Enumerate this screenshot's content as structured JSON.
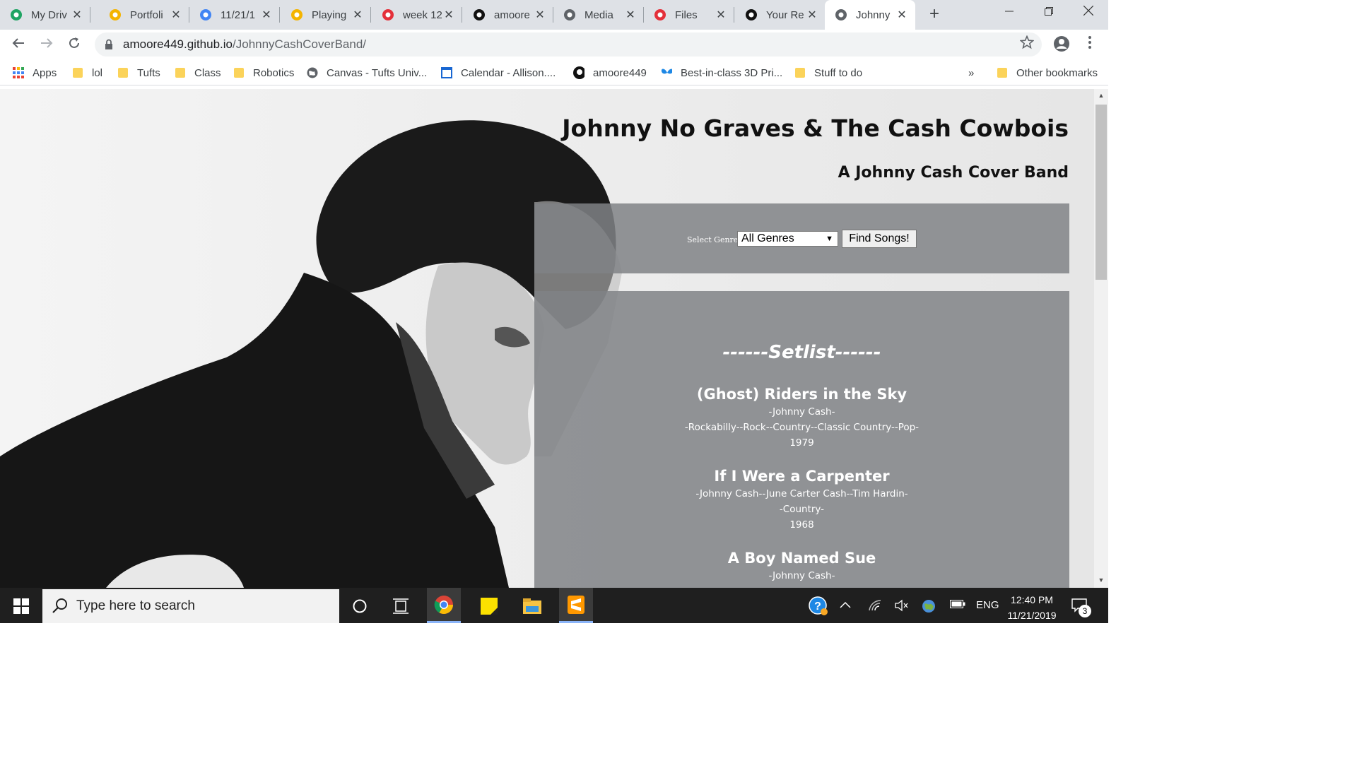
{
  "browser": {
    "tabs": [
      {
        "title": "My Driv",
        "icon": "google-drive-icon",
        "color": "#1fa463"
      },
      {
        "title": "Portfoli",
        "icon": "google-slides-icon",
        "color": "#f4b400"
      },
      {
        "title": "11/21/1",
        "icon": "google-docs-icon",
        "color": "#4285f4"
      },
      {
        "title": "Playing",
        "icon": "google-slides-icon",
        "color": "#f4b400"
      },
      {
        "title": "week 12",
        "icon": "canvas-icon",
        "color": "#e4303a"
      },
      {
        "title": "amoore",
        "icon": "github-icon",
        "color": "#111111"
      },
      {
        "title": "Media",
        "icon": "globe-icon",
        "color": "#5f6368"
      },
      {
        "title": "Files",
        "icon": "canvas-icon",
        "color": "#e4303a"
      },
      {
        "title": "Your Re",
        "icon": "github-icon",
        "color": "#111111"
      },
      {
        "title": "Johnny",
        "icon": "globe-icon",
        "color": "#5f6368"
      }
    ],
    "close_glyph": "✕",
    "url_host": "amoore449.github.io",
    "url_path": "/JohnnyCashCoverBand/",
    "bookmarks": [
      {
        "label": "Apps",
        "icon": "apps-grid-icon"
      },
      {
        "label": "lol",
        "icon": "folder-icon"
      },
      {
        "label": "Tufts",
        "icon": "folder-icon"
      },
      {
        "label": "Class",
        "icon": "folder-icon"
      },
      {
        "label": "Robotics",
        "icon": "folder-icon"
      },
      {
        "label": "Canvas - Tufts Univ...",
        "icon": "globe-icon"
      },
      {
        "label": "Calendar - Allison....",
        "icon": "calendar-icon"
      },
      {
        "label": "amoore449",
        "icon": "github-icon"
      },
      {
        "label": "Best-in-class 3D Pri...",
        "icon": "butterfly-icon"
      },
      {
        "label": "Stuff to do",
        "icon": "folder-icon"
      }
    ],
    "more_bookmarks": "»",
    "other_bookmarks": "Other bookmarks"
  },
  "page": {
    "title": "Johnny No Graves & The Cash Cowbois",
    "subtitle": "A Johnny Cash Cover Band",
    "genre_label": "Select Genre:",
    "genre_selected": "All Genres",
    "find_button": "Find Songs!",
    "setlist_title": "------Setlist------",
    "songs": [
      {
        "title": "(Ghost) Riders in the Sky",
        "artists": "-Johnny Cash-",
        "genres": "-Rockabilly--Rock--Country--Classic Country--Pop-",
        "year": "1979"
      },
      {
        "title": "If I Were a Carpenter",
        "artists": "-Johnny Cash--June Carter Cash--Tim Hardin-",
        "genres": "-Country-",
        "year": "1968"
      },
      {
        "title": "A Boy Named Sue",
        "artists": "-Johnny Cash-",
        "genres": "",
        "year": ""
      }
    ]
  },
  "taskbar": {
    "search_placeholder": "Type here to search",
    "time": "12:40 PM",
    "date": "11/21/2019",
    "language": "ENG",
    "notification_count": "3"
  }
}
